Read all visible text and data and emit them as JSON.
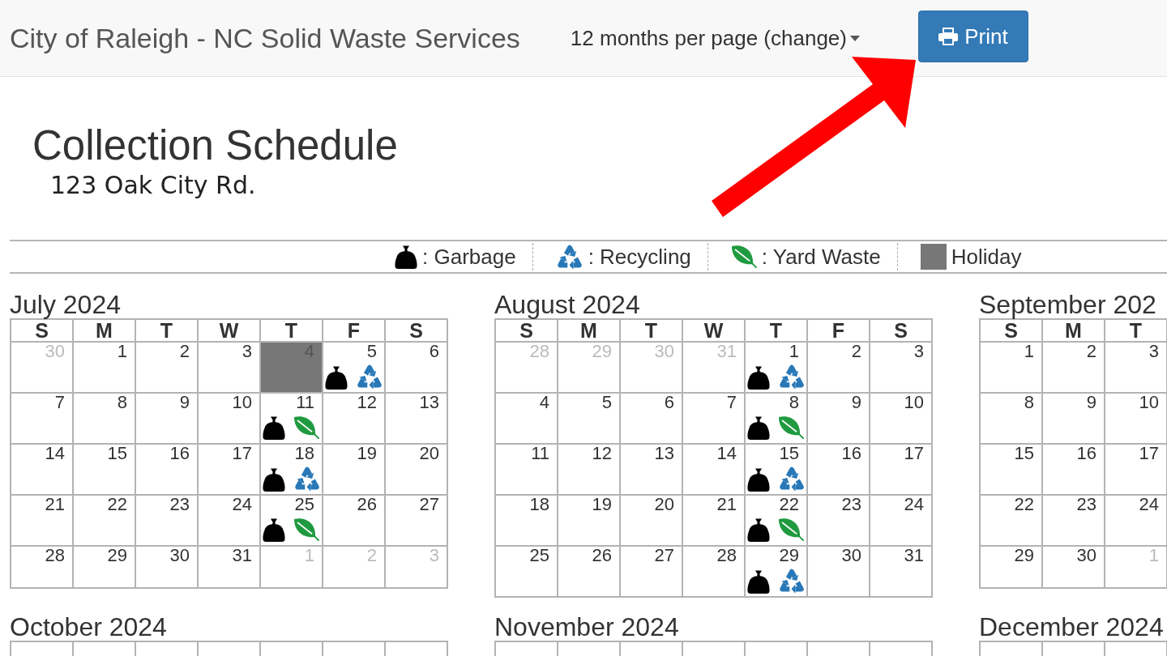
{
  "top_bar": {
    "title": "City of Raleigh - NC Solid Waste Services",
    "page_size_link": "12 months per page (change)",
    "print_button": "Print"
  },
  "heading": {
    "title": "Collection Schedule",
    "address": "123 Oak City Rd."
  },
  "legend": [
    {
      "kind": "garbage",
      "label": ": Garbage"
    },
    {
      "kind": "recycling",
      "label": ": Recycling"
    },
    {
      "kind": "yard_waste",
      "label": ": Yard Waste"
    },
    {
      "kind": "holiday",
      "label": "Holiday"
    }
  ],
  "months": [
    {
      "title": "July 2024",
      "weekdays": [
        "S",
        "M",
        "T",
        "W",
        "T",
        "F",
        "S"
      ],
      "weeks": [
        [
          {
            "day": "30",
            "outside_month": true,
            "holiday": false
          },
          {
            "day": "1",
            "outside_month": false,
            "holiday": false
          },
          {
            "day": "2",
            "outside_month": false,
            "holiday": false
          },
          {
            "day": "3",
            "outside_month": false,
            "holiday": false
          },
          {
            "day": "4",
            "outside_month": false,
            "holiday": true
          },
          {
            "day": "5",
            "outside_month": false,
            "holiday": false,
            "pickups": [
              {
                "kind": "garbage"
              },
              {
                "kind": "recycling"
              }
            ]
          },
          {
            "day": "6",
            "outside_month": false,
            "holiday": false
          }
        ],
        [
          {
            "day": "7",
            "outside_month": false,
            "holiday": false
          },
          {
            "day": "8",
            "outside_month": false,
            "holiday": false
          },
          {
            "day": "9",
            "outside_month": false,
            "holiday": false
          },
          {
            "day": "10",
            "outside_month": false,
            "holiday": false
          },
          {
            "day": "11",
            "outside_month": false,
            "holiday": false,
            "pickups": [
              {
                "kind": "garbage"
              },
              {
                "kind": "yard_waste"
              }
            ]
          },
          {
            "day": "12",
            "outside_month": false,
            "holiday": false
          },
          {
            "day": "13",
            "outside_month": false,
            "holiday": false
          }
        ],
        [
          {
            "day": "14",
            "outside_month": false,
            "holiday": false
          },
          {
            "day": "15",
            "outside_month": false,
            "holiday": false
          },
          {
            "day": "16",
            "outside_month": false,
            "holiday": false
          },
          {
            "day": "17",
            "outside_month": false,
            "holiday": false
          },
          {
            "day": "18",
            "outside_month": false,
            "holiday": false,
            "pickups": [
              {
                "kind": "garbage"
              },
              {
                "kind": "recycling"
              }
            ]
          },
          {
            "day": "19",
            "outside_month": false,
            "holiday": false
          },
          {
            "day": "20",
            "outside_month": false,
            "holiday": false
          }
        ],
        [
          {
            "day": "21",
            "outside_month": false,
            "holiday": false
          },
          {
            "day": "22",
            "outside_month": false,
            "holiday": false
          },
          {
            "day": "23",
            "outside_month": false,
            "holiday": false
          },
          {
            "day": "24",
            "outside_month": false,
            "holiday": false
          },
          {
            "day": "25",
            "outside_month": false,
            "holiday": false,
            "pickups": [
              {
                "kind": "garbage"
              },
              {
                "kind": "yard_waste"
              }
            ]
          },
          {
            "day": "26",
            "outside_month": false,
            "holiday": false
          },
          {
            "day": "27",
            "outside_month": false,
            "holiday": false
          }
        ],
        [
          {
            "day": "28",
            "outside_month": false,
            "holiday": false
          },
          {
            "day": "29",
            "outside_month": false,
            "holiday": false
          },
          {
            "day": "30",
            "outside_month": false,
            "holiday": false
          },
          {
            "day": "31",
            "outside_month": false,
            "holiday": false
          },
          {
            "day": "1",
            "outside_month": true,
            "holiday": false
          },
          {
            "day": "2",
            "outside_month": true,
            "holiday": false
          },
          {
            "day": "3",
            "outside_month": true,
            "holiday": false
          }
        ]
      ]
    },
    {
      "title": "August 2024",
      "weekdays": [
        "S",
        "M",
        "T",
        "W",
        "T",
        "F",
        "S"
      ],
      "weeks": [
        [
          {
            "day": "28",
            "outside_month": true,
            "holiday": false
          },
          {
            "day": "29",
            "outside_month": true,
            "holiday": false
          },
          {
            "day": "30",
            "outside_month": true,
            "holiday": false
          },
          {
            "day": "31",
            "outside_month": true,
            "holiday": false
          },
          {
            "day": "1",
            "outside_month": false,
            "holiday": false,
            "pickups": [
              {
                "kind": "garbage"
              },
              {
                "kind": "recycling"
              }
            ]
          },
          {
            "day": "2",
            "outside_month": false,
            "holiday": false
          },
          {
            "day": "3",
            "outside_month": false,
            "holiday": false
          }
        ],
        [
          {
            "day": "4",
            "outside_month": false,
            "holiday": false
          },
          {
            "day": "5",
            "outside_month": false,
            "holiday": false
          },
          {
            "day": "6",
            "outside_month": false,
            "holiday": false
          },
          {
            "day": "7",
            "outside_month": false,
            "holiday": false
          },
          {
            "day": "8",
            "outside_month": false,
            "holiday": false,
            "pickups": [
              {
                "kind": "garbage"
              },
              {
                "kind": "yard_waste"
              }
            ]
          },
          {
            "day": "9",
            "outside_month": false,
            "holiday": false
          },
          {
            "day": "10",
            "outside_month": false,
            "holiday": false
          }
        ],
        [
          {
            "day": "11",
            "outside_month": false,
            "holiday": false
          },
          {
            "day": "12",
            "outside_month": false,
            "holiday": false
          },
          {
            "day": "13",
            "outside_month": false,
            "holiday": false
          },
          {
            "day": "14",
            "outside_month": false,
            "holiday": false
          },
          {
            "day": "15",
            "outside_month": false,
            "holiday": false,
            "pickups": [
              {
                "kind": "garbage"
              },
              {
                "kind": "recycling"
              }
            ]
          },
          {
            "day": "16",
            "outside_month": false,
            "holiday": false
          },
          {
            "day": "17",
            "outside_month": false,
            "holiday": false
          }
        ],
        [
          {
            "day": "18",
            "outside_month": false,
            "holiday": false
          },
          {
            "day": "19",
            "outside_month": false,
            "holiday": false
          },
          {
            "day": "20",
            "outside_month": false,
            "holiday": false
          },
          {
            "day": "21",
            "outside_month": false,
            "holiday": false
          },
          {
            "day": "22",
            "outside_month": false,
            "holiday": false,
            "pickups": [
              {
                "kind": "garbage"
              },
              {
                "kind": "yard_waste"
              }
            ]
          },
          {
            "day": "23",
            "outside_month": false,
            "holiday": false
          },
          {
            "day": "24",
            "outside_month": false,
            "holiday": false
          }
        ],
        [
          {
            "day": "25",
            "outside_month": false,
            "holiday": false
          },
          {
            "day": "26",
            "outside_month": false,
            "holiday": false
          },
          {
            "day": "27",
            "outside_month": false,
            "holiday": false
          },
          {
            "day": "28",
            "outside_month": false,
            "holiday": false
          },
          {
            "day": "29",
            "outside_month": false,
            "holiday": false,
            "pickups": [
              {
                "kind": "garbage"
              },
              {
                "kind": "recycling"
              }
            ]
          },
          {
            "day": "30",
            "outside_month": false,
            "holiday": false
          },
          {
            "day": "31",
            "outside_month": false,
            "holiday": false
          }
        ]
      ]
    },
    {
      "title": "September 202",
      "weekdays": [
        "S",
        "M",
        "T"
      ],
      "weeks": [
        [
          {
            "day": "1",
            "outside_month": false,
            "holiday": false
          },
          {
            "day": "2",
            "outside_month": false,
            "holiday": false
          },
          {
            "day": "3",
            "outside_month": false,
            "holiday": false
          }
        ],
        [
          {
            "day": "8",
            "outside_month": false,
            "holiday": false
          },
          {
            "day": "9",
            "outside_month": false,
            "holiday": false
          },
          {
            "day": "10",
            "outside_month": false,
            "holiday": false
          }
        ],
        [
          {
            "day": "15",
            "outside_month": false,
            "holiday": false
          },
          {
            "day": "16",
            "outside_month": false,
            "holiday": false
          },
          {
            "day": "17",
            "outside_month": false,
            "holiday": false
          }
        ],
        [
          {
            "day": "22",
            "outside_month": false,
            "holiday": false
          },
          {
            "day": "23",
            "outside_month": false,
            "holiday": false
          },
          {
            "day": "24",
            "outside_month": false,
            "holiday": false
          }
        ],
        [
          {
            "day": "29",
            "outside_month": false,
            "holiday": false
          },
          {
            "day": "30",
            "outside_month": false,
            "holiday": false
          },
          {
            "day": "1",
            "outside_month": true,
            "holiday": false
          }
        ]
      ]
    },
    {
      "title": "October 2024"
    },
    {
      "title": "November 2024"
    },
    {
      "title": "December 2024"
    }
  ]
}
